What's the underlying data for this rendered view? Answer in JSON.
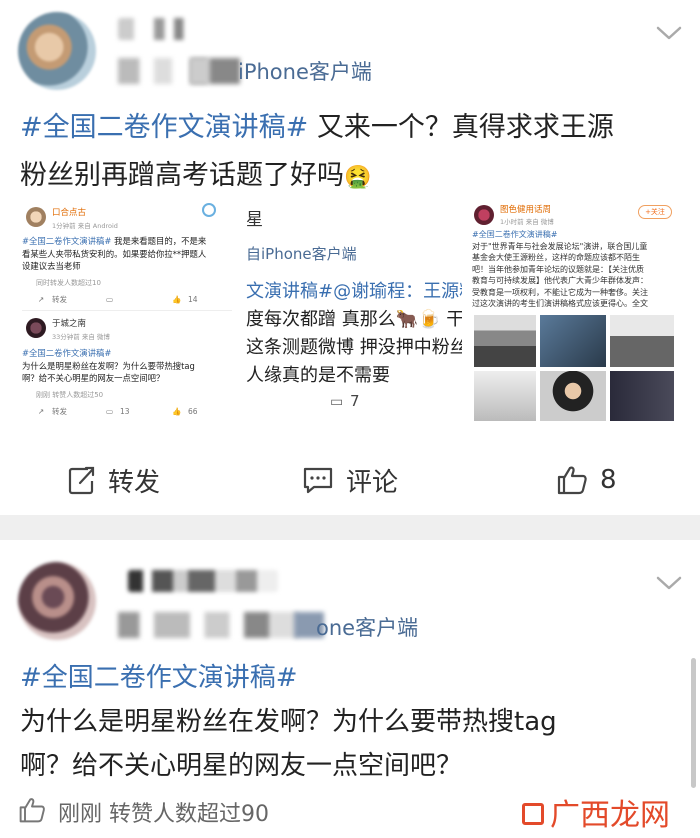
{
  "post1": {
    "source": "iPhone客户端",
    "hashtag": "#全国二卷作文演讲稿#",
    "text_line1": " 又来一个？真得求求王源",
    "text_line2": "粉丝别再蹭高考话题了好吗",
    "emoji": "🤮",
    "thumb1": {
      "a": {
        "name": "口合点古",
        "meta": "1分钟前 来自 Android",
        "tag": "#全国二卷作文演讲稿#",
        "line1": " 我是来看题目的，不是来",
        "line2": "看某些人夹带私货安利的。如果要给你拉**押题人",
        "line3": "设建议去当老师",
        "foot": "同时转发人数超过10",
        "repost": "转发",
        "likes": "14"
      },
      "b": {
        "name": "于城之南",
        "meta": "33分钟前 来自 微博",
        "tag": "#全国二卷作文演讲稿#",
        "line1": "为什么是明星粉丝在发啊？为什么要带热搜tag",
        "line2": "啊？给不关心明星的网友一点空间吧？",
        "foot": "刚刚 转赞人数超过50",
        "repost": "转发",
        "comments": "13",
        "likes": "66"
      }
    },
    "thumb2": {
      "l1": "星",
      "l2": "自iPhone客户端",
      "l3": "文演讲稿#@谢瑜程：王源粉",
      "l4": "度每次都蹭 真那么🐂🍺 干",
      "l5": "这条测题微博 押没押中粉丝",
      "l6": "人缘真的是不需要",
      "comments": "7"
    },
    "thumb3": {
      "name": "图色健用话周",
      "meta": "1小时前 来自 微博",
      "follow": "+关注",
      "tag": "#全国二卷作文演讲稿#",
      "line1": "对于\"世界青年与社会发展论坛\"演讲，联合国儿童",
      "line2": "基金会大使王源粉丝，这样的命题应该都不陌生",
      "line3": "吧！当年他参加青年论坛的议题就是：【关注优质",
      "line4": "教育与可持续发展】他代表广大青少年群体发声：",
      "line5": "受教育是一项权利，不能让它成为一种奢侈。关注",
      "line6": "过这次演讲的考生们演讲稿格式应该更得心。全文"
    },
    "actions": {
      "repost": "转发",
      "comment": "评论",
      "likes": "8"
    }
  },
  "post2": {
    "source": "one客户端",
    "hashtag": "#全国二卷作文演讲稿#",
    "text_line1": "为什么是明星粉丝在发啊？为什么要带热搜tag",
    "text_line2": "啊？给不关心明星的网友一点空间吧？",
    "footer": "刚刚 转赞人数超过90"
  },
  "watermark": "广西龙网"
}
